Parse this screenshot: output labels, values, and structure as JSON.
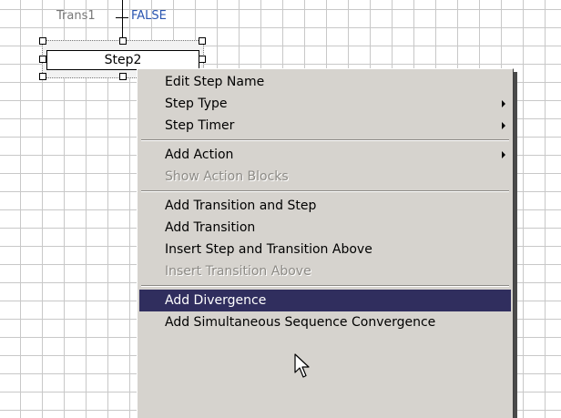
{
  "diagram": {
    "transition": {
      "name": "Trans1",
      "condition": "FALSE"
    },
    "step": {
      "name": "Step2"
    }
  },
  "context_menu": {
    "groups": [
      [
        {
          "label": "Edit Step Name",
          "enabled": true,
          "submenu": false
        },
        {
          "label": "Step Type",
          "enabled": true,
          "submenu": true
        },
        {
          "label": "Step Timer",
          "enabled": true,
          "submenu": true
        }
      ],
      [
        {
          "label": "Add Action",
          "enabled": true,
          "submenu": true
        },
        {
          "label": "Show Action Blocks",
          "enabled": false,
          "submenu": false
        }
      ],
      [
        {
          "label": "Add Transition and Step",
          "enabled": true,
          "submenu": false
        },
        {
          "label": "Add Transition",
          "enabled": true,
          "submenu": false
        },
        {
          "label": "Insert Step and Transition Above",
          "enabled": true,
          "submenu": false
        },
        {
          "label": "Insert Transition Above",
          "enabled": false,
          "submenu": false
        }
      ],
      [
        {
          "label": "Add Divergence",
          "enabled": true,
          "submenu": false,
          "selected": true
        },
        {
          "label": "Add Simultaneous Sequence Convergence",
          "enabled": true,
          "submenu": false
        }
      ]
    ]
  },
  "colors": {
    "menu_bg": "#d6d3ce",
    "highlight": "#302e5e",
    "condition_text": "#2a55b0"
  },
  "icons": {
    "cursor": "arrow-pointer-icon",
    "submenu": "submenu-arrow-icon"
  }
}
